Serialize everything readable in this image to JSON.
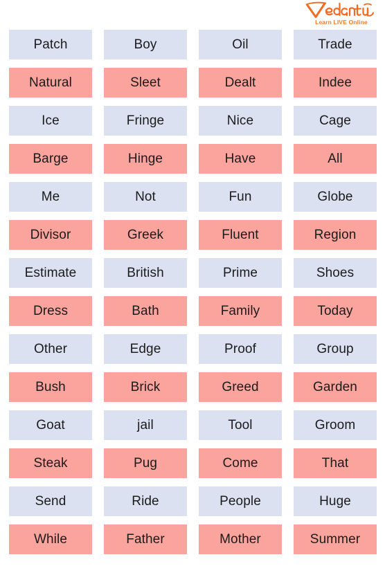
{
  "brand": {
    "name": "Vedantu",
    "tagline": "Learn LIVE Online",
    "logo_color": "#f26b22",
    "tagline_color": "#f47b28"
  },
  "grid": {
    "columns": 4,
    "rows": 14,
    "colors": {
      "blue": "#dce1f2",
      "pink": "#fba49d",
      "text": "#1b1b1b",
      "background": "#ffffff"
    },
    "rows_data": [
      {
        "tone": "blue",
        "words": [
          "Patch",
          "Boy",
          "Oil",
          "Trade"
        ]
      },
      {
        "tone": "pink",
        "words": [
          "Natural",
          "Sleet",
          "Dealt",
          "Indee"
        ]
      },
      {
        "tone": "blue",
        "words": [
          "Ice",
          "Fringe",
          "Nice",
          "Cage"
        ]
      },
      {
        "tone": "pink",
        "words": [
          "Barge",
          "Hinge",
          "Have",
          "All"
        ]
      },
      {
        "tone": "blue",
        "words": [
          "Me",
          "Not",
          "Fun",
          "Globe"
        ]
      },
      {
        "tone": "pink",
        "words": [
          "Divisor",
          "Greek",
          "Fluent",
          "Region"
        ]
      },
      {
        "tone": "blue",
        "words": [
          "Estimate",
          "British",
          "Prime",
          "Shoes"
        ]
      },
      {
        "tone": "pink",
        "words": [
          "Dress",
          "Bath",
          "Family",
          "Today"
        ]
      },
      {
        "tone": "blue",
        "words": [
          "Other",
          "Edge",
          "Proof",
          "Group"
        ]
      },
      {
        "tone": "pink",
        "words": [
          "Bush",
          "Brick",
          "Greed",
          "Garden"
        ]
      },
      {
        "tone": "blue",
        "words": [
          "Goat",
          "jail",
          "Tool",
          "Groom"
        ]
      },
      {
        "tone": "pink",
        "words": [
          "Steak",
          "Pug",
          "Come",
          "That"
        ]
      },
      {
        "tone": "blue",
        "words": [
          "Send",
          "Ride",
          "People",
          "Huge"
        ]
      },
      {
        "tone": "pink",
        "words": [
          "While",
          "Father",
          "Mother",
          "Summer"
        ]
      }
    ]
  }
}
